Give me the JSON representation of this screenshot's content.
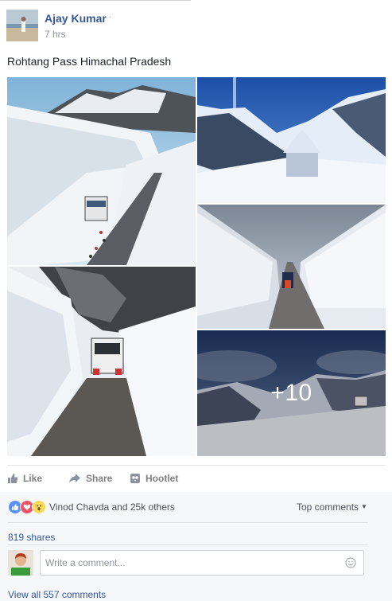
{
  "post": {
    "author": "Ajay Kumar",
    "time": "7 hrs",
    "text": "Rohtang Pass Himachal Pradesh",
    "more_photos_label": "+10"
  },
  "actions": {
    "like_label": "Like",
    "share_label": "Share",
    "hootlet_label": "Hootlet"
  },
  "engagement": {
    "reactors": "Vinod Chavda and 25k others",
    "top_comments_label": "Top comments",
    "shares": "819 shares",
    "view_all_comments": "View all 557 comments"
  },
  "comment_box": {
    "placeholder": "Write a comment..."
  },
  "colors": {
    "link_blue": "#365899",
    "like_blue": "#5890ff",
    "love_red": "#f25268",
    "wow_yellow": "#fcd95b"
  },
  "icons": [
    "thumbs-up-icon",
    "share-arrow-icon",
    "hootlet-icon",
    "like-reaction-icon",
    "love-reaction-icon",
    "wow-reaction-icon",
    "smiley-icon"
  ]
}
